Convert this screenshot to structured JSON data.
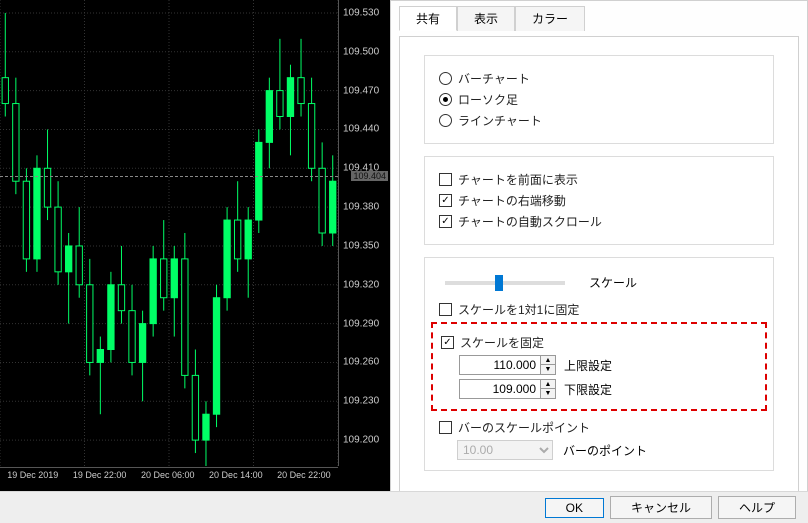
{
  "tabs": {
    "share": "共有",
    "view": "表示",
    "color": "カラー",
    "active": "share"
  },
  "chart_types": {
    "bar": "バーチャート",
    "candle": "ローソク足",
    "line": "ラインチャート",
    "selected": "candle"
  },
  "display": {
    "foreground": {
      "label": "チャートを前面に表示",
      "checked": false
    },
    "shift": {
      "label": "チャートの右端移動",
      "checked": true
    },
    "autoscroll": {
      "label": "チャートの自動スクロール",
      "checked": true
    }
  },
  "scale": {
    "label": "スケール",
    "fix_1to1": {
      "label": "スケールを1対1に固定",
      "checked": false
    },
    "fix": {
      "label": "スケールを固定",
      "checked": true
    },
    "upper": {
      "value": "110.000",
      "label": "上限設定"
    },
    "lower": {
      "value": "109.000",
      "label": "下限設定"
    },
    "bar_point": {
      "label": "バーのスケールポイント",
      "checked": false
    },
    "point_value": "10.00",
    "point_label": "バーのポイント",
    "slider_pct": 45
  },
  "buttons": {
    "ok": "OK",
    "cancel": "キャンセル",
    "help": "ヘルプ"
  },
  "chart_data": {
    "type": "candlestick",
    "ylim": [
      109.18,
      109.54
    ],
    "current_price": 109.404,
    "y_ticks": [
      109.53,
      109.5,
      109.47,
      109.44,
      109.41,
      109.38,
      109.35,
      109.32,
      109.29,
      109.26,
      109.23,
      109.2
    ],
    "x_ticks": [
      "19 Dec 2019",
      "19 Dec 22:00",
      "20 Dec 06:00",
      "20 Dec 14:00",
      "20 Dec 22:00"
    ],
    "candles": [
      {
        "o": 109.48,
        "h": 109.53,
        "l": 109.45,
        "c": 109.46
      },
      {
        "o": 109.46,
        "h": 109.48,
        "l": 109.39,
        "c": 109.4
      },
      {
        "o": 109.4,
        "h": 109.41,
        "l": 109.33,
        "c": 109.34
      },
      {
        "o": 109.34,
        "h": 109.42,
        "l": 109.33,
        "c": 109.41
      },
      {
        "o": 109.41,
        "h": 109.44,
        "l": 109.37,
        "c": 109.38
      },
      {
        "o": 109.38,
        "h": 109.4,
        "l": 109.32,
        "c": 109.33
      },
      {
        "o": 109.33,
        "h": 109.36,
        "l": 109.29,
        "c": 109.35
      },
      {
        "o": 109.35,
        "h": 109.38,
        "l": 109.31,
        "c": 109.32
      },
      {
        "o": 109.32,
        "h": 109.34,
        "l": 109.25,
        "c": 109.26
      },
      {
        "o": 109.26,
        "h": 109.28,
        "l": 109.22,
        "c": 109.27
      },
      {
        "o": 109.27,
        "h": 109.33,
        "l": 109.26,
        "c": 109.32
      },
      {
        "o": 109.32,
        "h": 109.35,
        "l": 109.29,
        "c": 109.3
      },
      {
        "o": 109.3,
        "h": 109.32,
        "l": 109.25,
        "c": 109.26
      },
      {
        "o": 109.26,
        "h": 109.3,
        "l": 109.23,
        "c": 109.29
      },
      {
        "o": 109.29,
        "h": 109.35,
        "l": 109.28,
        "c": 109.34
      },
      {
        "o": 109.34,
        "h": 109.37,
        "l": 109.3,
        "c": 109.31
      },
      {
        "o": 109.31,
        "h": 109.35,
        "l": 109.28,
        "c": 109.34
      },
      {
        "o": 109.34,
        "h": 109.36,
        "l": 109.24,
        "c": 109.25
      },
      {
        "o": 109.25,
        "h": 109.27,
        "l": 109.19,
        "c": 109.2
      },
      {
        "o": 109.2,
        "h": 109.23,
        "l": 109.18,
        "c": 109.22
      },
      {
        "o": 109.22,
        "h": 109.32,
        "l": 109.21,
        "c": 109.31
      },
      {
        "o": 109.31,
        "h": 109.38,
        "l": 109.3,
        "c": 109.37
      },
      {
        "o": 109.37,
        "h": 109.4,
        "l": 109.33,
        "c": 109.34
      },
      {
        "o": 109.34,
        "h": 109.38,
        "l": 109.31,
        "c": 109.37
      },
      {
        "o": 109.37,
        "h": 109.44,
        "l": 109.36,
        "c": 109.43
      },
      {
        "o": 109.43,
        "h": 109.48,
        "l": 109.41,
        "c": 109.47
      },
      {
        "o": 109.47,
        "h": 109.51,
        "l": 109.44,
        "c": 109.45
      },
      {
        "o": 109.45,
        "h": 109.49,
        "l": 109.42,
        "c": 109.48
      },
      {
        "o": 109.48,
        "h": 109.51,
        "l": 109.45,
        "c": 109.46
      },
      {
        "o": 109.46,
        "h": 109.48,
        "l": 109.4,
        "c": 109.41
      },
      {
        "o": 109.41,
        "h": 109.43,
        "l": 109.35,
        "c": 109.36
      },
      {
        "o": 109.36,
        "h": 109.42,
        "l": 109.35,
        "c": 109.4
      }
    ]
  }
}
